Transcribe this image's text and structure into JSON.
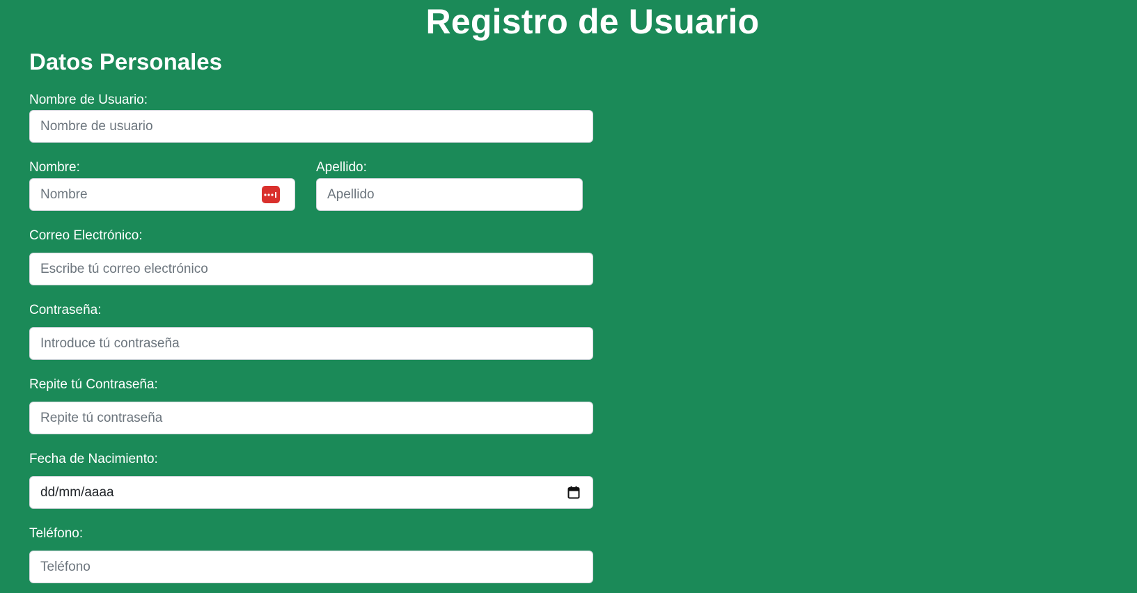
{
  "page": {
    "title": "Registro de Usuario",
    "section_title": "Datos Personales"
  },
  "form": {
    "username": {
      "label": "Nombre de Usuario:",
      "placeholder": "Nombre de usuario",
      "value": ""
    },
    "first_name": {
      "label": "Nombre:",
      "placeholder": "Nombre",
      "value": ""
    },
    "last_name": {
      "label": "Apellido:",
      "placeholder": "Apellido",
      "value": ""
    },
    "email": {
      "label": "Correo Electrónico:",
      "placeholder": "Escribe tú correo electrónico",
      "value": ""
    },
    "password": {
      "label": "Contraseña:",
      "placeholder": "Introduce tú contraseña",
      "value": ""
    },
    "password_repeat": {
      "label": "Repite tú Contraseña:",
      "placeholder": "Repite tú contraseña",
      "value": ""
    },
    "birth_date": {
      "label": "Fecha de Nacimiento:",
      "display": "dd/mm/aaaa"
    },
    "phone": {
      "label": "Teléfono:",
      "placeholder": "Teléfono",
      "value": ""
    }
  },
  "icons": {
    "password_manager": "password-manager-icon",
    "calendar": "calendar-icon"
  },
  "colors": {
    "background": "#1b8a58",
    "text": "#ffffff",
    "input_background": "#ffffff",
    "placeholder": "#6c757d",
    "password_manager_badge": "#d9302c"
  }
}
